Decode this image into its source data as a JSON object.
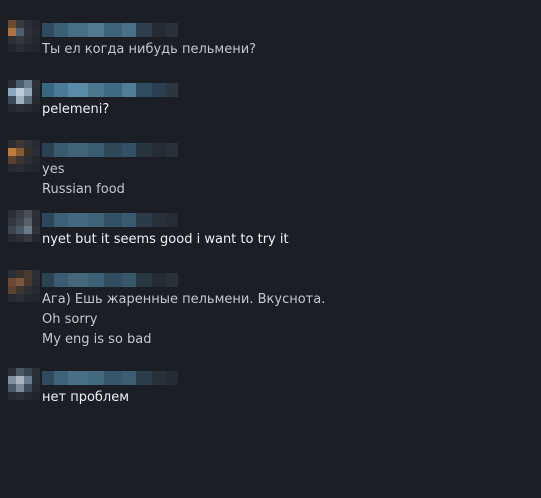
{
  "messages": [
    {
      "sender": "",
      "avatar_colors": [
        "#6a4a30",
        "#3a3a3a",
        "#2a2d33",
        "#24272c",
        "#b07040",
        "#4a6070",
        "#2e3238",
        "#262a30",
        "#2c2f35",
        "#34383e",
        "#2a2d33",
        "#24272c",
        "#222529",
        "#2a2d33",
        "#24272c",
        "#222529"
      ],
      "name_colors": [
        "#2f4a5c",
        "#3c5f74",
        "#466e85",
        "#527a90",
        "#3e6278",
        "#4a7085",
        "#2d3e4a",
        "#252b32",
        "#2a3139"
      ],
      "lines": [
        "Ты ел когда нибудь пельмени?"
      ],
      "bright": false
    },
    {
      "sender": "",
      "avatar_colors": [
        "#2a2d33",
        "#4a5d70",
        "#6a8090",
        "#2f3338",
        "#8aa8c0",
        "#c0ccd5",
        "#90a8b8",
        "#2a2f35",
        "#3a4a58",
        "#a0b0bc",
        "#5a6c78",
        "#262a30",
        "#24272c",
        "#2a2d33",
        "#262a30",
        "#222529"
      ],
      "name_colors": [
        "#3a6580",
        "#4a7a95",
        "#5a8ca8",
        "#4c7890",
        "#3e6a82",
        "#517e96",
        "#2f4c5e",
        "#2a3f4f",
        "#2c3640"
      ],
      "lines": [
        "pelemeni?"
      ],
      "bright": true
    },
    {
      "sender": "",
      "avatar_colors": [
        "#2a2d33",
        "#3e3630",
        "#2f3338",
        "#262a30",
        "#c07a40",
        "#8a5a30",
        "#3a2e28",
        "#2a2d33",
        "#5a4030",
        "#3a342f",
        "#2c2f35",
        "#24272c",
        "#26292e",
        "#2a2d33",
        "#24272c",
        "#222529"
      ],
      "name_colors": [
        "#2c4252",
        "#3a5a6e",
        "#406478",
        "#3a5c70",
        "#2e4858",
        "#345064",
        "#28343e",
        "#262c33",
        "#2a3038"
      ],
      "lines": [
        "yes",
        "Russian food"
      ],
      "bright": false
    },
    {
      "sender": "",
      "avatar_colors": [
        "#2a2d33",
        "#3a3e44",
        "#4a4f56",
        "#2c3036",
        "#34383e",
        "#3f454c",
        "#566068",
        "#2a2e34",
        "#3c4550",
        "#4a5865",
        "#6a7a88",
        "#2f343a",
        "#262a30",
        "#2c3036",
        "#343a40",
        "#24272c"
      ],
      "name_colors": [
        "#2d4758",
        "#3c6177",
        "#44697f",
        "#3e6379",
        "#325166",
        "#3a5a70",
        "#2a3a46",
        "#283038",
        "#262c33"
      ],
      "lines": [
        "nyet but it seems good i want to try it"
      ],
      "bright": true
    },
    {
      "sender": "",
      "avatar_colors": [
        "#2a2d33",
        "#3a3430",
        "#4a3a30",
        "#2c2f35",
        "#6a4a35",
        "#7a5640",
        "#4a382c",
        "#2a2d33",
        "#5a4535",
        "#3e3430",
        "#2c2f35",
        "#262a30",
        "#26292e",
        "#2a2d33",
        "#24272c",
        "#222529"
      ],
      "name_colors": [
        "#2a4252",
        "#3a5c70",
        "#44677c",
        "#3c6075",
        "#304e60",
        "#37566a",
        "#283640",
        "#252b32",
        "#2a3139"
      ],
      "lines": [
        "Ага) Ешь жаренные пельмени. Вкуснота.",
        "Oh sorry",
        "My eng is so bad"
      ],
      "bright": false
    },
    {
      "sender": "",
      "avatar_colors": [
        "#2a2d33",
        "#4a5865",
        "#3a444e",
        "#2c3036",
        "#8090a0",
        "#a8b4c0",
        "#6a7c8c",
        "#2a2f35",
        "#4a5a68",
        "#7a8a98",
        "#3e4a55",
        "#262a30",
        "#26292e",
        "#2c3036",
        "#24272c",
        "#222529"
      ],
      "name_colors": [
        "#2f4a5c",
        "#3e6278",
        "#486f85",
        "#43697f",
        "#35566b",
        "#3c5e73",
        "#2c3c48",
        "#283038",
        "#252b32"
      ],
      "lines": [
        "нет проблем"
      ],
      "bright": true
    }
  ]
}
